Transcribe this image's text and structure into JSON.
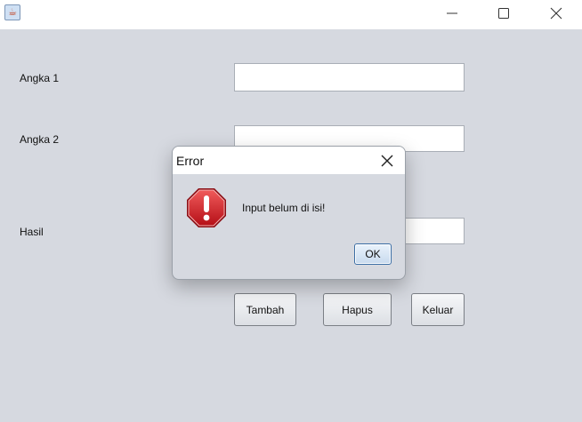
{
  "window": {
    "title": "",
    "icon": "java-cup-icon",
    "controls": [
      "minimize",
      "maximize",
      "close"
    ]
  },
  "form": {
    "angka1_label": "Angka 1",
    "angka1_value": "",
    "angka2_label": "Angka 2",
    "angka2_value": "",
    "hasil_label": "Hasil",
    "hasil_value": "",
    "buttons": {
      "tambah": "Tambah",
      "hapus": "Hapus",
      "keluar": "Keluar"
    }
  },
  "dialog": {
    "title": "Error",
    "icon": "error-stop-icon",
    "message": "Input belum di isi!",
    "ok_label": "OK"
  },
  "colors": {
    "background": "#d6d9e0",
    "titlebar": "#ffffff",
    "error_red": "#c8141c"
  }
}
